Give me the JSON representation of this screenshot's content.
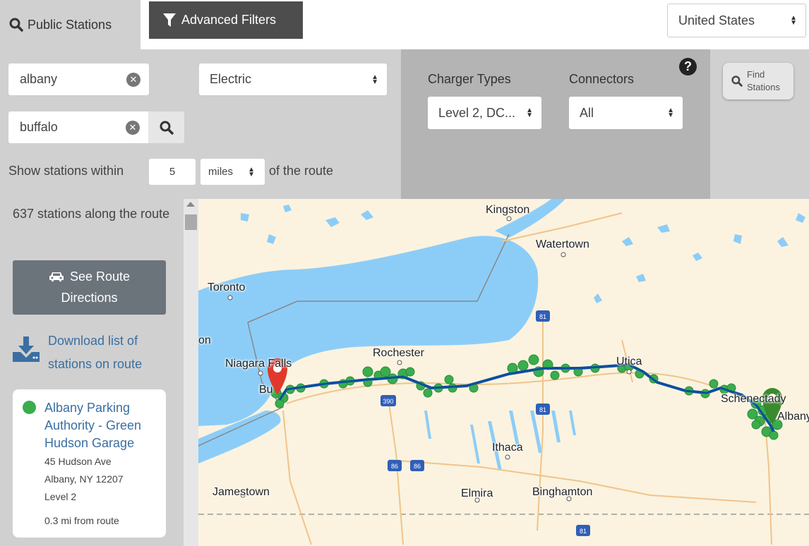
{
  "tabs": {
    "public": "Public Stations",
    "advanced": "Advanced Filters"
  },
  "country": "United States",
  "search": {
    "from": "albany",
    "to": "buffalo",
    "fuel": "Electric",
    "within_prefix": "Show stations within",
    "within_value": "5",
    "units": "miles",
    "within_suffix": "of the route"
  },
  "filters": {
    "charger_label": "Charger Types",
    "charger_value": "Level 2, DC...",
    "connectors_label": "Connectors",
    "connectors_value": "All",
    "help": "?",
    "find_line1": "Find",
    "find_line2": "Stations"
  },
  "sidebar": {
    "count_text": "637 stations along the route",
    "route_btn_line1": "See Route",
    "route_btn_line2": "Directions",
    "download_line1": "Download list of",
    "download_line2": "stations on route",
    "station": {
      "name": "Albany Parking Authority - Green Hudson Garage",
      "address1": "45 Hudson Ave",
      "address2": "Albany, NY 12207",
      "level": "Level 2",
      "distance": "0.3 mi from route"
    }
  },
  "map": {
    "cities": [
      "Kingston",
      "Watertown",
      "Toronto",
      "Rochester",
      "Niagara Falls",
      "Utica",
      "Schenectady",
      "Albany",
      "Ithaca",
      "Jamestown",
      "Elmira",
      "Binghamton",
      "Bu",
      "on"
    ],
    "highways": [
      "81",
      "390",
      "81",
      "86",
      "86",
      "81"
    ],
    "colors": {
      "water": "#8ccdf8",
      "land": "#fbf3df",
      "route": "#0a4fa0",
      "station": "#3aad4d",
      "start_pin": "#e0392b",
      "end_pin": "#3a8a2e"
    }
  }
}
